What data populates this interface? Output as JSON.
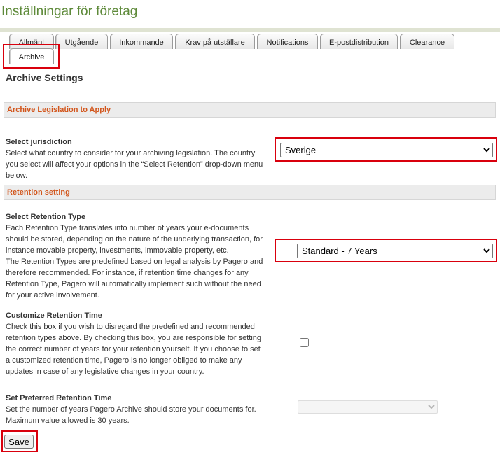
{
  "page": {
    "title": "Inställningar för företag"
  },
  "tabs": [
    {
      "label": "Allmänt"
    },
    {
      "label": "Utgående"
    },
    {
      "label": "Inkommande"
    },
    {
      "label": "Krav på utställare"
    },
    {
      "label": "Notifications"
    },
    {
      "label": "E-postdistribution"
    },
    {
      "label": "Clearance"
    },
    {
      "label": "Archive",
      "active": true
    }
  ],
  "archive": {
    "heading": "Archive Settings",
    "legislation_section": "Archive Legislation to Apply",
    "jurisdiction": {
      "label": "Select jurisdiction",
      "description": "Select what country to consider for your archiving legislation. The country you select will affect your options in the “Select Retention” drop-down menu below.",
      "selected": "Sverige"
    },
    "retention_section": "Retention setting",
    "retention_type": {
      "label": "Select Retention Type",
      "description_1": "Each Retention Type translates into number of years your e-documents should be stored, depending on the nature of the underlying transaction, for instance movable property, investments, immovable property, etc.",
      "description_2": "The Retention Types are predefined based on legal analysis by Pagero and therefore recommended. For instance, if retention time changes for any Retention Type, Pagero will automatically implement such without the need for your active involvement.",
      "selected": "Standard - 7 Years"
    },
    "customize_retention": {
      "label": "Customize Retention Time",
      "description": "Check this box if you wish to disregard the predefined and recommended retention types above. By checking this box, you are responsible for setting the correct number of years for your retention yourself. If you choose to set a customized retention time, Pagero is no longer obliged to make any updates in case of any legislative changes in your country.",
      "checked": false
    },
    "preferred_retention": {
      "label": "Set Preferred Retention Time",
      "description": "Set the number of years Pagero Archive should store your documents for. Maximum value allowed is 30 years.",
      "selected": ""
    },
    "save_label": "Save"
  },
  "colors": {
    "title_green": "#5e8a3a",
    "section_orange": "#d2551b",
    "highlight_red": "#d9000d"
  }
}
